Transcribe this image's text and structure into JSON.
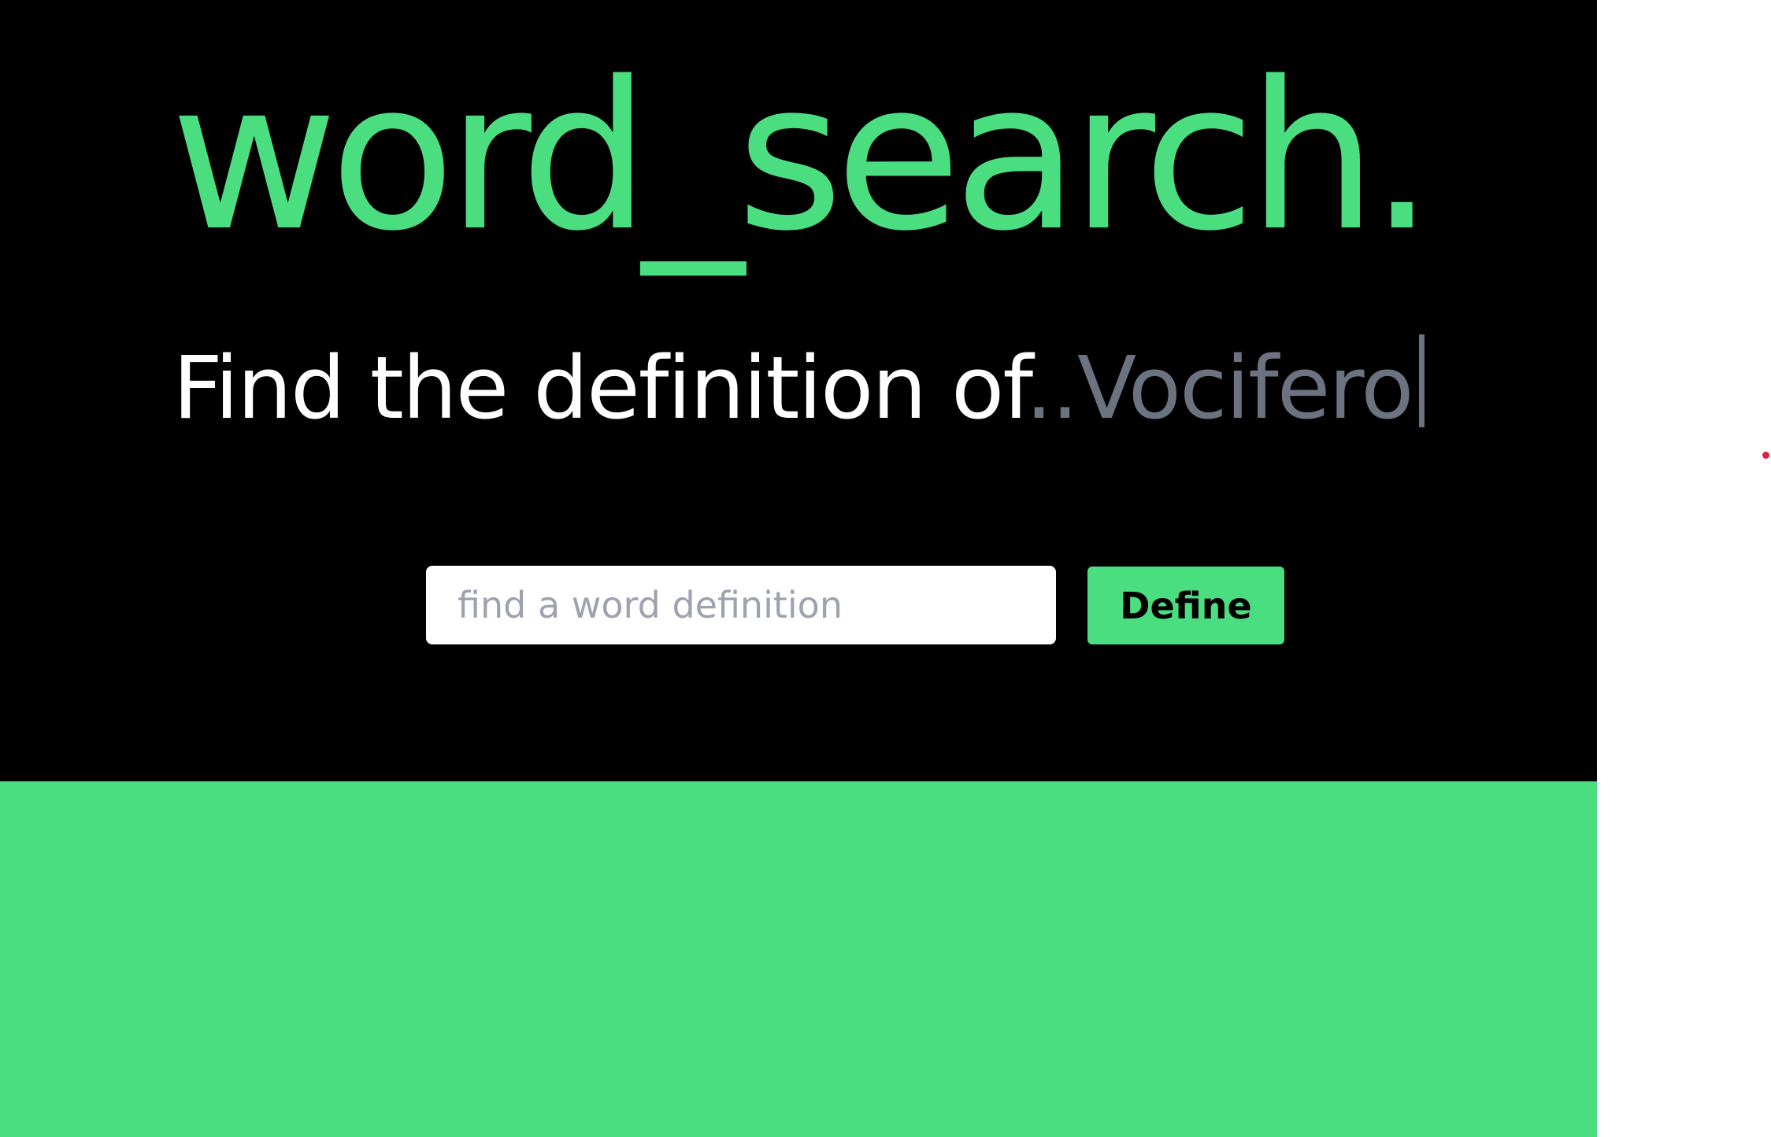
{
  "hero": {
    "title": "word_search.",
    "subtitle": {
      "prefix": "Find the definition of",
      "dots": "..",
      "typed_word": "Vocifero"
    }
  },
  "search": {
    "placeholder": "find a word definition",
    "value": ""
  },
  "define_button": {
    "label": "Define"
  },
  "colors": {
    "accent": "#4ade80",
    "hero_background": "#000000",
    "subtitle_text": "#ffffff",
    "typed_text": "#6b7280",
    "placeholder_text": "#9ca3af",
    "indicator_dot": "#e11d48"
  }
}
